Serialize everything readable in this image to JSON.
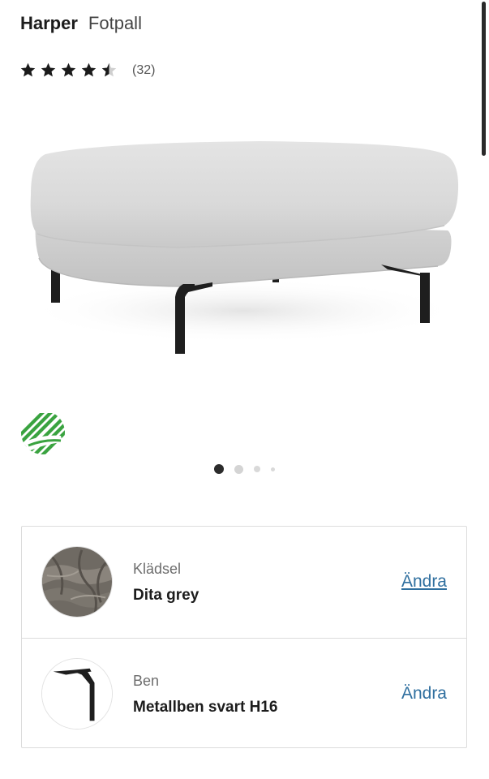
{
  "product": {
    "brand": "Harper",
    "type": "Fotpall"
  },
  "rating": {
    "value": 4.5,
    "max": 5,
    "count_text": "(32)"
  },
  "gallery": {
    "image_icon": "ottoman-photo",
    "page_count": 4,
    "active_index": 0
  },
  "eco_label": {
    "icon": "nordic-swan-ecolabel-icon",
    "color": "#3aa340"
  },
  "options": [
    {
      "label": "Klädsel",
      "value": "Dita grey",
      "action": "Ändra",
      "thumb_icon": "fabric-swatch-icon"
    },
    {
      "label": "Ben",
      "value": "Metallben svart H16",
      "action": "Ändra",
      "thumb_icon": "metal-leg-icon"
    }
  ],
  "colors": {
    "link": "#2f6f9f",
    "fabric": "#d8d8d8",
    "legs": "#1e1e1e"
  }
}
